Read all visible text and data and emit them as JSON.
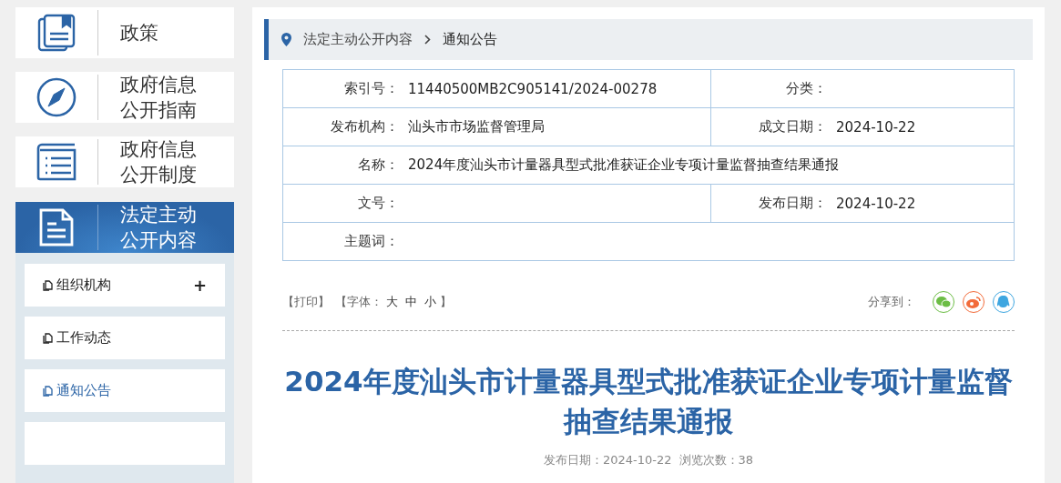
{
  "sidebar": {
    "items": [
      {
        "kind": "book",
        "label": "政策",
        "selected": false
      },
      {
        "kind": "compass",
        "label": "政府信息公开指南",
        "selected": false
      },
      {
        "kind": "list",
        "label": "政府信息公开制度",
        "selected": false
      },
      {
        "kind": "document",
        "label": "法定主动公开内容",
        "selected": true
      }
    ],
    "submenu": [
      {
        "label": "组织机构",
        "toggle": "+",
        "selected": false
      },
      {
        "label": "工作动态",
        "selected": false
      },
      {
        "label": "通知公告",
        "selected": true
      }
    ]
  },
  "breadcrumb": [
    "法定主动公开内容",
    "通知公告"
  ],
  "meta_table": {
    "rows": [
      {
        "cells": [
          {
            "label": "索引号：",
            "value": "11440500MB2C905141/2024-00278"
          },
          {
            "label": "分类："
          }
        ]
      },
      {
        "cells": [
          {
            "label": "发布机构：",
            "value": "汕头市市场监督管理局"
          },
          {
            "label": "成文日期：",
            "value": "2024-10-22"
          }
        ]
      },
      {
        "cells": [
          {
            "label": "名称：",
            "value": "2024年度汕头市计量器具型式批准获证企业专项计量监督抽查结果通报"
          }
        ]
      },
      {
        "cells": [
          {
            "label": "文号："
          },
          {
            "label": "发布日期：",
            "value": "2024-10-22"
          }
        ]
      },
      {
        "cells": [
          {
            "label": "主题词："
          }
        ]
      }
    ]
  },
  "tools": {
    "print": "【打印】",
    "font_label": "【字体：",
    "font_sizes": [
      "大",
      "中",
      "小"
    ],
    "font_end": "】",
    "share_label": "分享到：",
    "share": [
      {
        "kind": "wechat",
        "color": "#6cbd45"
      },
      {
        "kind": "weibo",
        "color": "#f26b3a"
      },
      {
        "kind": "qq",
        "color": "#3ea6e0"
      }
    ]
  },
  "article": {
    "title": "2024年度汕头市计量器具型式批准获证企业专项计量监督抽查结果通报",
    "publish_date": "发布日期：2024-10-22",
    "views": "浏览次数：38"
  }
}
